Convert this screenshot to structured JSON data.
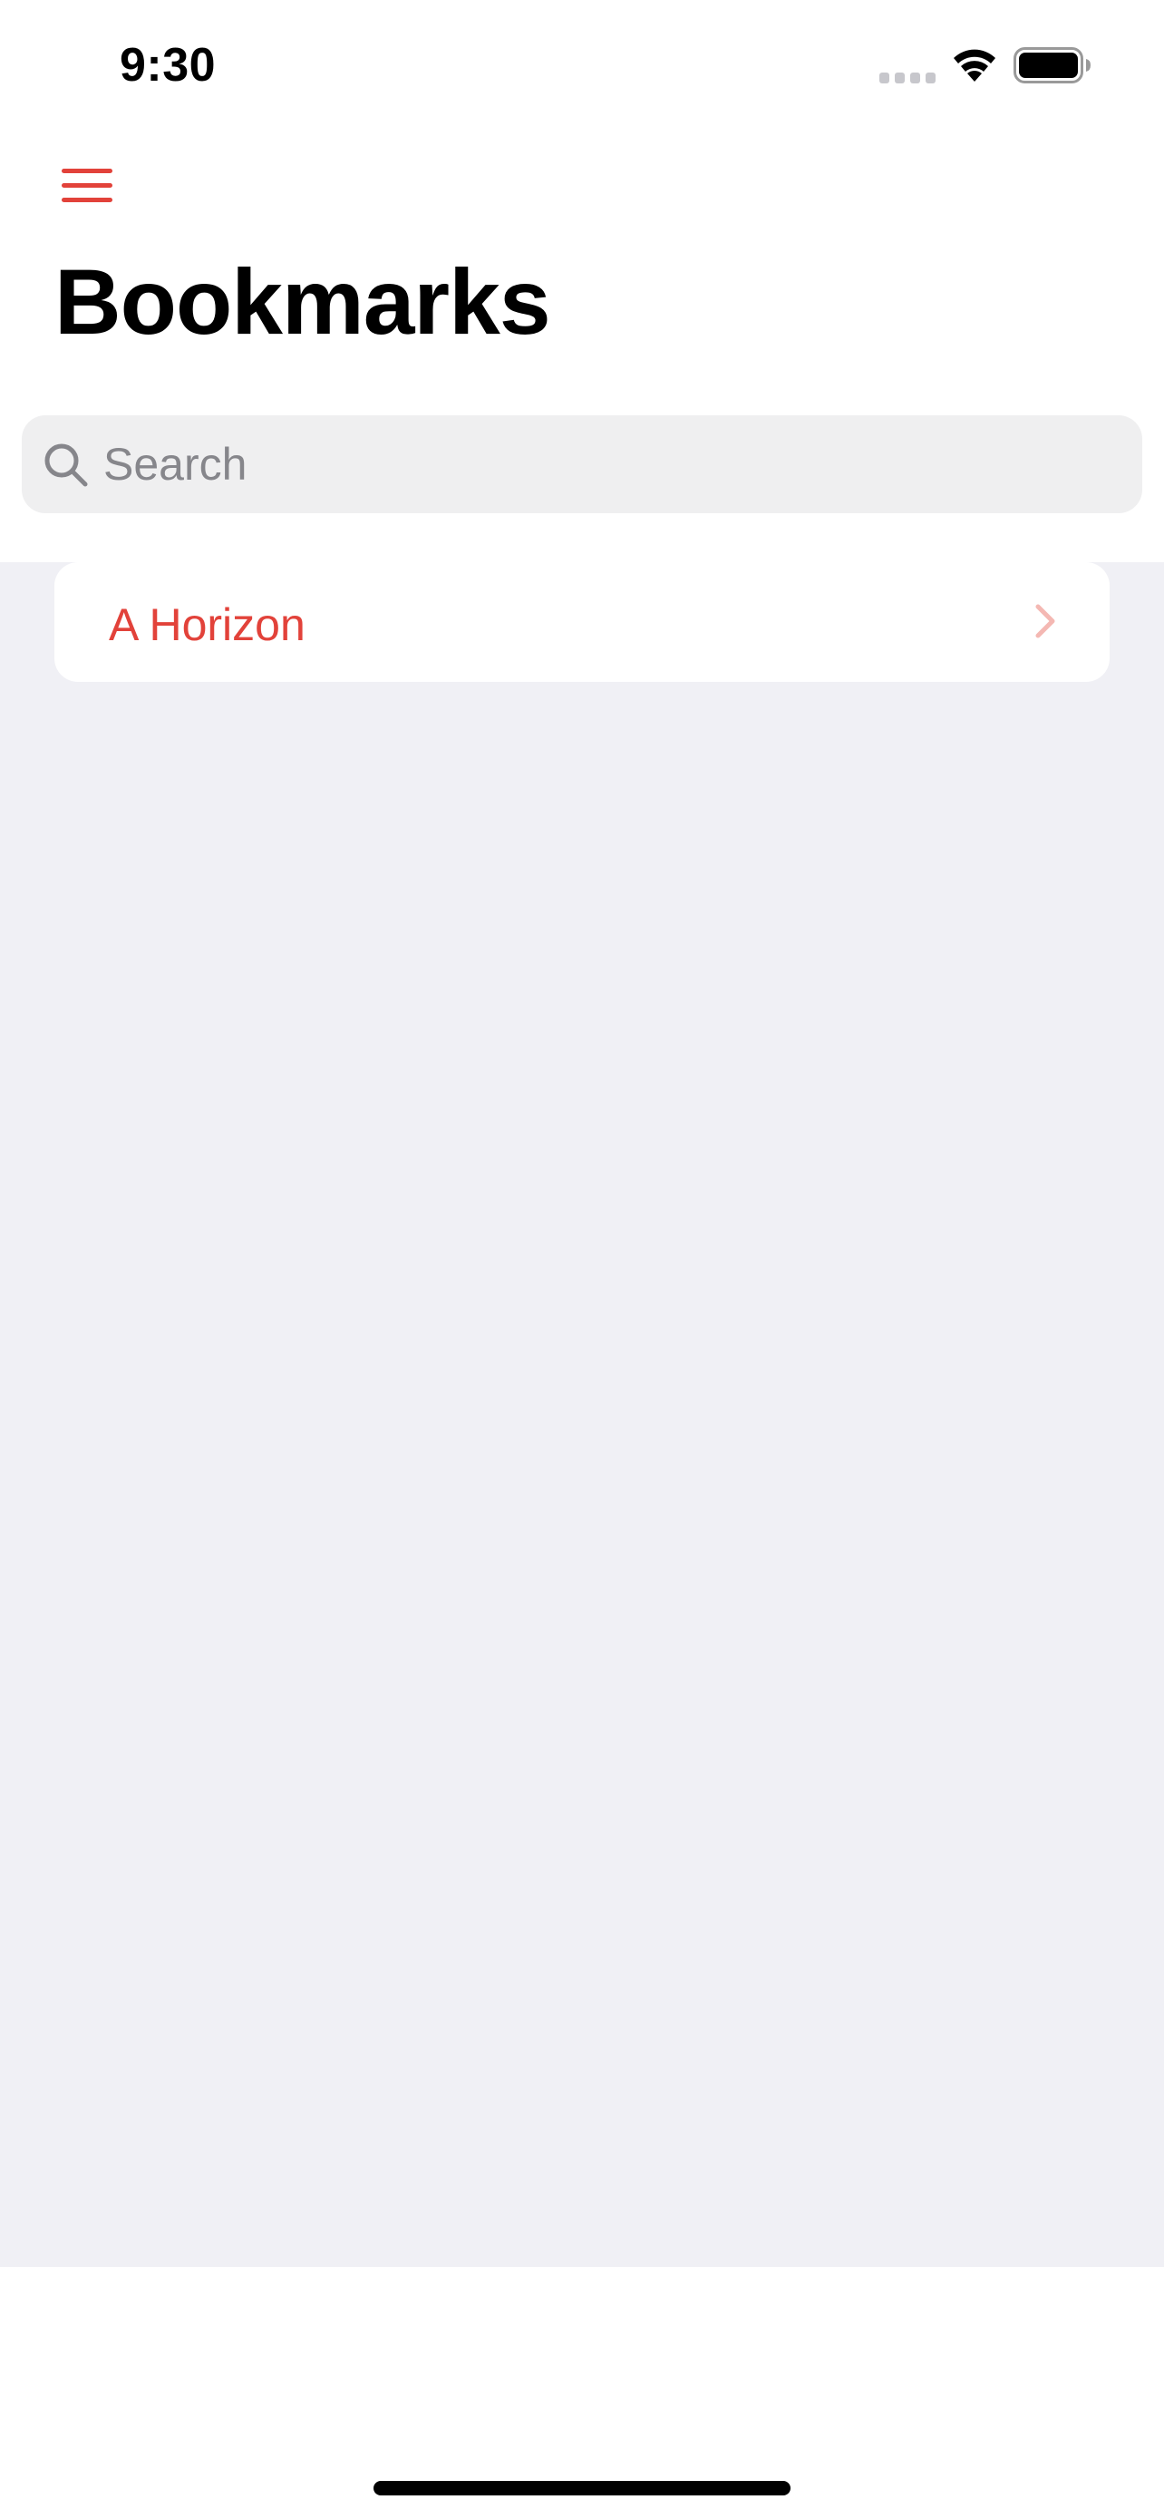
{
  "status_bar": {
    "time": "9:30"
  },
  "nav": {
    "menu_icon": "hamburger-menu-icon",
    "title": "Bookmarks"
  },
  "search": {
    "placeholder": "Search",
    "value": ""
  },
  "bookmarks": [
    {
      "label": "A Horizon"
    }
  ],
  "colors": {
    "accent": "#e2423a",
    "chevron": "#f4b8b3",
    "list_background": "#f0f0f5",
    "search_background": "#efeff0"
  }
}
